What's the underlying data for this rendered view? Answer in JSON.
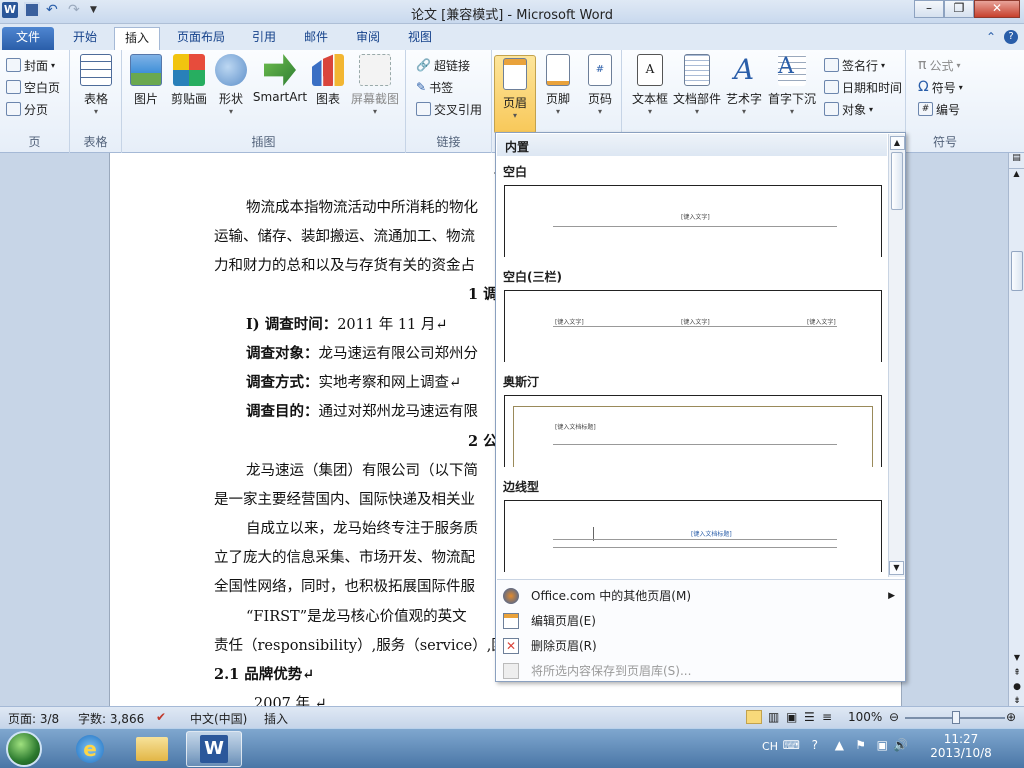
{
  "window": {
    "title": "论文 [兼容模式] - Microsoft Word",
    "qat": {
      "logo": "W"
    }
  },
  "tabs": [
    "文件",
    "开始",
    "插入",
    "页面布局",
    "引用",
    "邮件",
    "审阅",
    "视图"
  ],
  "active_tab": "插入",
  "ribbon": {
    "pages_group": {
      "label": "页",
      "cover": "封面",
      "blank": "空白页",
      "break": "分页"
    },
    "table_group": {
      "label": "表格",
      "table": "表格"
    },
    "illustrations_group": {
      "label": "插图",
      "picture": "图片",
      "clipart": "剪贴画",
      "shapes": "形状",
      "smartart": "SmartArt",
      "chart": "图表",
      "screenshot": "屏幕截图"
    },
    "links_group": {
      "label": "链接",
      "hyperlink": "超链接",
      "bookmark": "书签",
      "crossref": "交叉引用"
    },
    "hf_group": {
      "header": "页眉",
      "footer": "页脚",
      "pagenum": "页码"
    },
    "text_group": {
      "textbox": "文本框",
      "quickparts": "文档部件",
      "wordart": "艺术字",
      "dropcap": "首字下沉",
      "signature": "签名行",
      "datetime": "日期和时间",
      "object": "对象"
    },
    "symbols_group": {
      "label": "符号",
      "equation": "公式",
      "symbol": "符号",
      "number": "编号"
    }
  },
  "document": {
    "lines": [
      {
        "text": "物流成本指物流活动中所消耗的物化",
        "bold": false
      },
      {
        "text": "运输、储存、装卸搬运、流通加工、物流",
        "bold": false
      },
      {
        "text": "力和财力的总和以及与存货有关的资金占",
        "bold": false
      },
      {
        "text": "1  调",
        "bold": true
      },
      {
        "label": "I)   调查时间：",
        "value": "2011 年 11 月↵"
      },
      {
        "label": "调查对象：",
        "value": "龙马速运有限公司郑州分"
      },
      {
        "label": "调查方式：",
        "value": "实地考察和网上调查↵"
      },
      {
        "label": "调查目的：",
        "value": "通过对郑州龙马速运有限"
      },
      {
        "text": "2  公",
        "bold": true
      },
      {
        "text": "龙马速运（集团）有限公司（以下简",
        "bold": false
      },
      {
        "text": "是一家主要经营国内、国际快递及相关业",
        "bold": false
      },
      {
        "text": "自成立以来，龙马始终专注于服务质",
        "bold": false
      },
      {
        "text": "立了庞大的信息采集、市场开发、物流配",
        "bold": false
      },
      {
        "text": "全国性网络，同时，也积极拓展国际件服",
        "bold": false
      },
      {
        "text": "“FIRST”是龙马核心价值观的英文",
        "bold": false
      },
      {
        "text": "责任（responsibility）,服务（service）,团",
        "bold": false
      },
      {
        "text": "2.1  品牌优势↵",
        "bold": true
      },
      {
        "text": "2007 年 ↵",
        "bold": false
      }
    ],
    "heading_fragment": "前"
  },
  "header_gallery": {
    "section_title": "内置",
    "items": [
      {
        "name": "空白",
        "placeholders": [
          "[键入文字]"
        ]
      },
      {
        "name": "空白(三栏)",
        "placeholders": [
          "[键入文字]",
          "[键入文字]",
          "[键入文字]"
        ]
      },
      {
        "name": "奥斯汀",
        "placeholders": [
          "[键入文档标题]"
        ]
      },
      {
        "name": "边线型",
        "placeholders": [
          "[键入文档标题]"
        ]
      }
    ],
    "menu": [
      {
        "label": "Office.com 中的其他页眉(M)",
        "enabled": true,
        "has_submenu": true
      },
      {
        "label": "编辑页眉(E)",
        "enabled": true
      },
      {
        "label": "删除页眉(R)",
        "enabled": true
      },
      {
        "label": "将所选内容保存到页眉库(S)...",
        "enabled": false
      }
    ]
  },
  "statusbar": {
    "page": "页面: 3/8",
    "words": "字数: 3,866",
    "language": "中文(中国)",
    "mode": "插入",
    "zoom": "100%",
    "zoom_level": 1.0
  },
  "taskbar": {
    "time": "11:27",
    "date": "2013/10/8",
    "ime": "CH"
  },
  "colors": {
    "file_tab": "#2a5ea9",
    "pressed_button": "#f8c859",
    "ribbon_bg": "#e6eef8",
    "taskbar": "#4a76a6"
  }
}
